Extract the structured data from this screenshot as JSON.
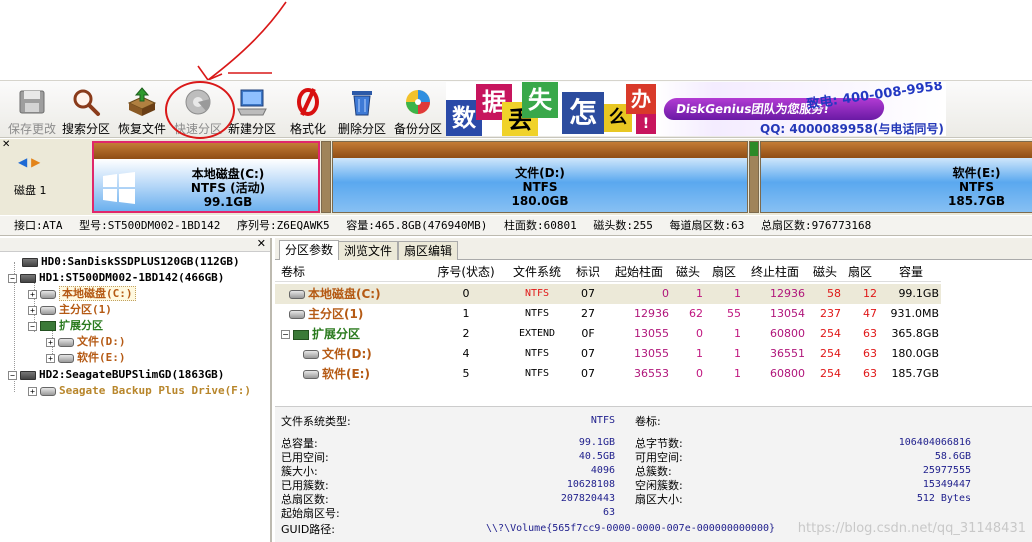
{
  "toolbar": {
    "buttons": [
      {
        "label": "保存更改",
        "icon": "save-icon"
      },
      {
        "label": "搜索分区",
        "icon": "search-icon"
      },
      {
        "label": "恢复文件",
        "icon": "recover-file-icon"
      },
      {
        "label": "快速分区",
        "icon": "quick-partition-icon"
      },
      {
        "label": "新建分区",
        "icon": "new-partition-icon"
      },
      {
        "label": "格式化",
        "icon": "format-icon"
      },
      {
        "label": "删除分区",
        "icon": "delete-partition-icon"
      },
      {
        "label": "备份分区",
        "icon": "backup-partition-icon"
      }
    ]
  },
  "banner": {
    "chars": [
      "数",
      "据",
      "丢",
      "失",
      "怎",
      "么",
      "办",
      "!"
    ],
    "pill": "DiskGenius团队为您服务!",
    "phone": "致电: 400-008-9958",
    "qq": "QQ: 4000089958(与电话同号)"
  },
  "disk_bar": {
    "disk_label": "磁盘 1",
    "partitions": [
      {
        "name": "本地磁盘(C:)",
        "fs": "NTFS (活动)",
        "size": "99.1GB"
      },
      {
        "name": "文件(D:)",
        "fs": "NTFS",
        "size": "180.0GB"
      },
      {
        "name": "软件(E:)",
        "fs": "NTFS",
        "size": "185.7GB"
      }
    ]
  },
  "info_line": {
    "interface": "接口:ATA",
    "model": "型号:ST500DM002-1BD142",
    "serial": "序列号:Z6EQAWK5",
    "capacity": "容量:465.8GB(476940MB)",
    "cylinders": "柱面数:60801",
    "heads": "磁头数:255",
    "sectors_per_track": "每道扇区数:63",
    "total_sectors": "总扇区数:976773168"
  },
  "tree": {
    "hd0": "HD0:SanDiskSSDPLUS120GB(112GB)",
    "hd1": "HD1:ST500DM002-1BD142(466GB)",
    "c": "本地磁盘(C:)",
    "primary": "主分区(1)",
    "extended": "扩展分区",
    "d": "文件(D:)",
    "e": "软件(E:)",
    "hd2": "HD2:SeagateBUPSlimGD(1863GB)",
    "f": "Seagate Backup Plus Drive(F:)"
  },
  "tabs": [
    "分区参数",
    "浏览文件",
    "扇区编辑"
  ],
  "table": {
    "headers": [
      "卷标",
      "序号(状态)",
      "文件系统",
      "标识",
      "起始柱面",
      "磁头",
      "扇区",
      "终止柱面",
      "磁头",
      "扇区",
      "容量"
    ],
    "rows": [
      [
        "本地磁盘(C:)",
        "0",
        "NTFS",
        "07",
        "0",
        "1",
        "1",
        "12936",
        "58",
        "12",
        "99.1GB"
      ],
      [
        "主分区(1)",
        "1",
        "NTFS",
        "27",
        "12936",
        "62",
        "55",
        "13054",
        "237",
        "47",
        "931.0MB"
      ],
      [
        "扩展分区",
        "2",
        "EXTEND",
        "0F",
        "13055",
        "0",
        "1",
        "60800",
        "254",
        "63",
        "365.8GB"
      ],
      [
        "文件(D:)",
        "4",
        "NTFS",
        "07",
        "13055",
        "1",
        "1",
        "36551",
        "254",
        "63",
        "180.0GB"
      ],
      [
        "软件(E:)",
        "5",
        "NTFS",
        "07",
        "36553",
        "0",
        "1",
        "60800",
        "254",
        "63",
        "185.7GB"
      ]
    ]
  },
  "fsinfo": {
    "fs_type_label": "文件系统类型:",
    "fs_type": "NTFS",
    "volume_label_label": "卷标:",
    "left": [
      {
        "label": "总容量:",
        "value": "99.1GB"
      },
      {
        "label": "已用空间:",
        "value": "40.5GB"
      },
      {
        "label": "簇大小:",
        "value": "4096"
      },
      {
        "label": "已用簇数:",
        "value": "10628108"
      },
      {
        "label": "总扇区数:",
        "value": "207820443"
      },
      {
        "label": "起始扇区号:",
        "value": "63"
      }
    ],
    "right": [
      {
        "label": "总字节数:",
        "value": "106404066816"
      },
      {
        "label": "可用空间:",
        "value": "58.6GB"
      },
      {
        "label": "总簇数:",
        "value": "25977555"
      },
      {
        "label": "空闲簇数:",
        "value": "15349447"
      },
      {
        "label": "扇区大小:",
        "value": "512 Bytes"
      }
    ],
    "guid_label": "GUID路径:",
    "guid": "\\\\?\\Volume{565f7cc9-0000-0000-007e-000000000000}",
    "watermark": "https://blog.csdn.net/qq_31148431"
  },
  "colors": {
    "annotation_red": "#d91818",
    "selected_border": "#e0276b",
    "partition_blue": "#5aa8ef",
    "partition_brown": "#8f4d15",
    "tree_brown": "#b55a14",
    "tree_green": "#2a7a1e"
  }
}
